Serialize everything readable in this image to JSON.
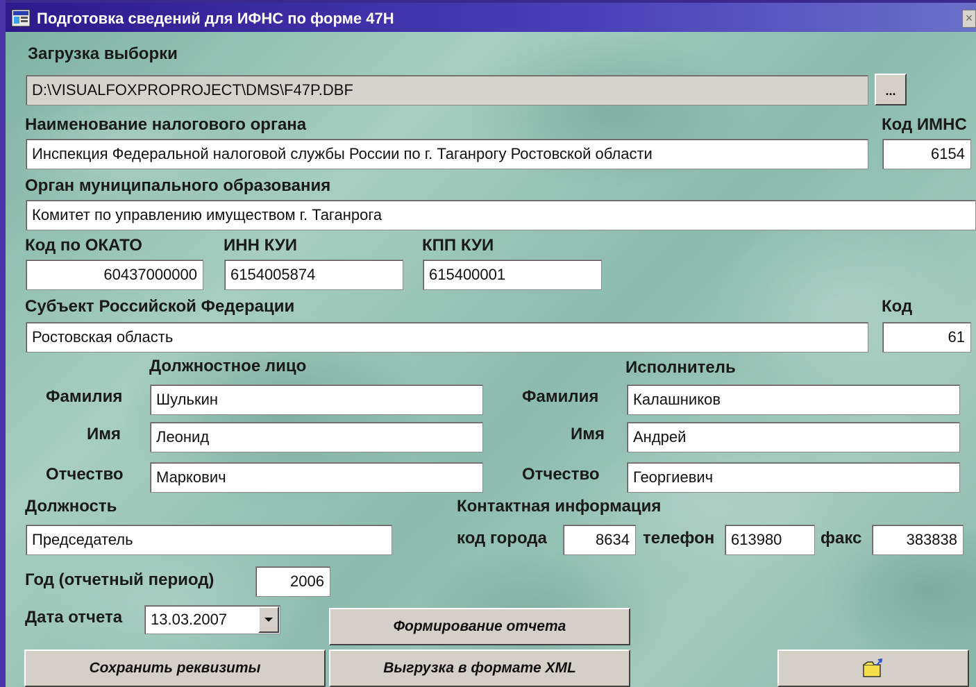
{
  "window": {
    "title": "Подготовка сведений для ИФНС по форме 47Н",
    "close": "×"
  },
  "load": {
    "label": "Загрузка выборки",
    "path": "D:\\VISUALFOXPROPROJECT\\DMS\\F47P.DBF",
    "browse": "..."
  },
  "tax_authority": {
    "name_label": "Наименование налогового органа",
    "name": "Инспекция Федеральной налоговой службы России по г. Таганрогу Ростовской области",
    "code_label": "Код ИМНС",
    "code": "6154"
  },
  "municipal": {
    "label": "Орган муниципального образования",
    "value": "Комитет по управлению имуществом г. Таганрога"
  },
  "codes": {
    "okato_label": "Код по ОКАТО",
    "okato": "60437000000",
    "inn_label": "ИНН КУИ",
    "inn": "6154005874",
    "kpp_label": "КПП КУИ",
    "kpp": "615400001"
  },
  "subject": {
    "label": "Субъект Российской Федерации",
    "value": "Ростовская область",
    "code_label": "Код",
    "code": "61"
  },
  "official": {
    "heading": "Должностное лицо",
    "surname_label": "Фамилия",
    "surname": "Шулькин",
    "name_label": "Имя",
    "name": "Леонид",
    "patronymic_label": "Отчество",
    "patronymic": "Маркович"
  },
  "executor": {
    "heading": "Исполнитель",
    "surname_label": "Фамилия",
    "surname": "Калашников",
    "name_label": "Имя",
    "name": "Андрей",
    "patronymic_label": "Отчество",
    "patronymic": "Георгиевич"
  },
  "position": {
    "label": "Должность",
    "value": "Председатель"
  },
  "contact": {
    "heading": "Контактная информация",
    "city_code_label": "код города",
    "city_code": "8634",
    "phone_label": "телефон",
    "phone": "613980",
    "fax_label": "факс",
    "fax": "383838"
  },
  "year": {
    "label": "Год (отчетный период)",
    "value": "2006"
  },
  "report_date": {
    "label": "Дата отчета",
    "value": "13.03.2007"
  },
  "buttons": {
    "generate": "Формирование отчета",
    "save": "Сохранить реквизиты",
    "export_xml": "Выгрузка в формате XML",
    "exit_icon": "folder-exit-icon"
  },
  "colors": {
    "titlebar": "#2d1a8c",
    "background": "#9cc4b6",
    "button": "#d4d0c8"
  }
}
